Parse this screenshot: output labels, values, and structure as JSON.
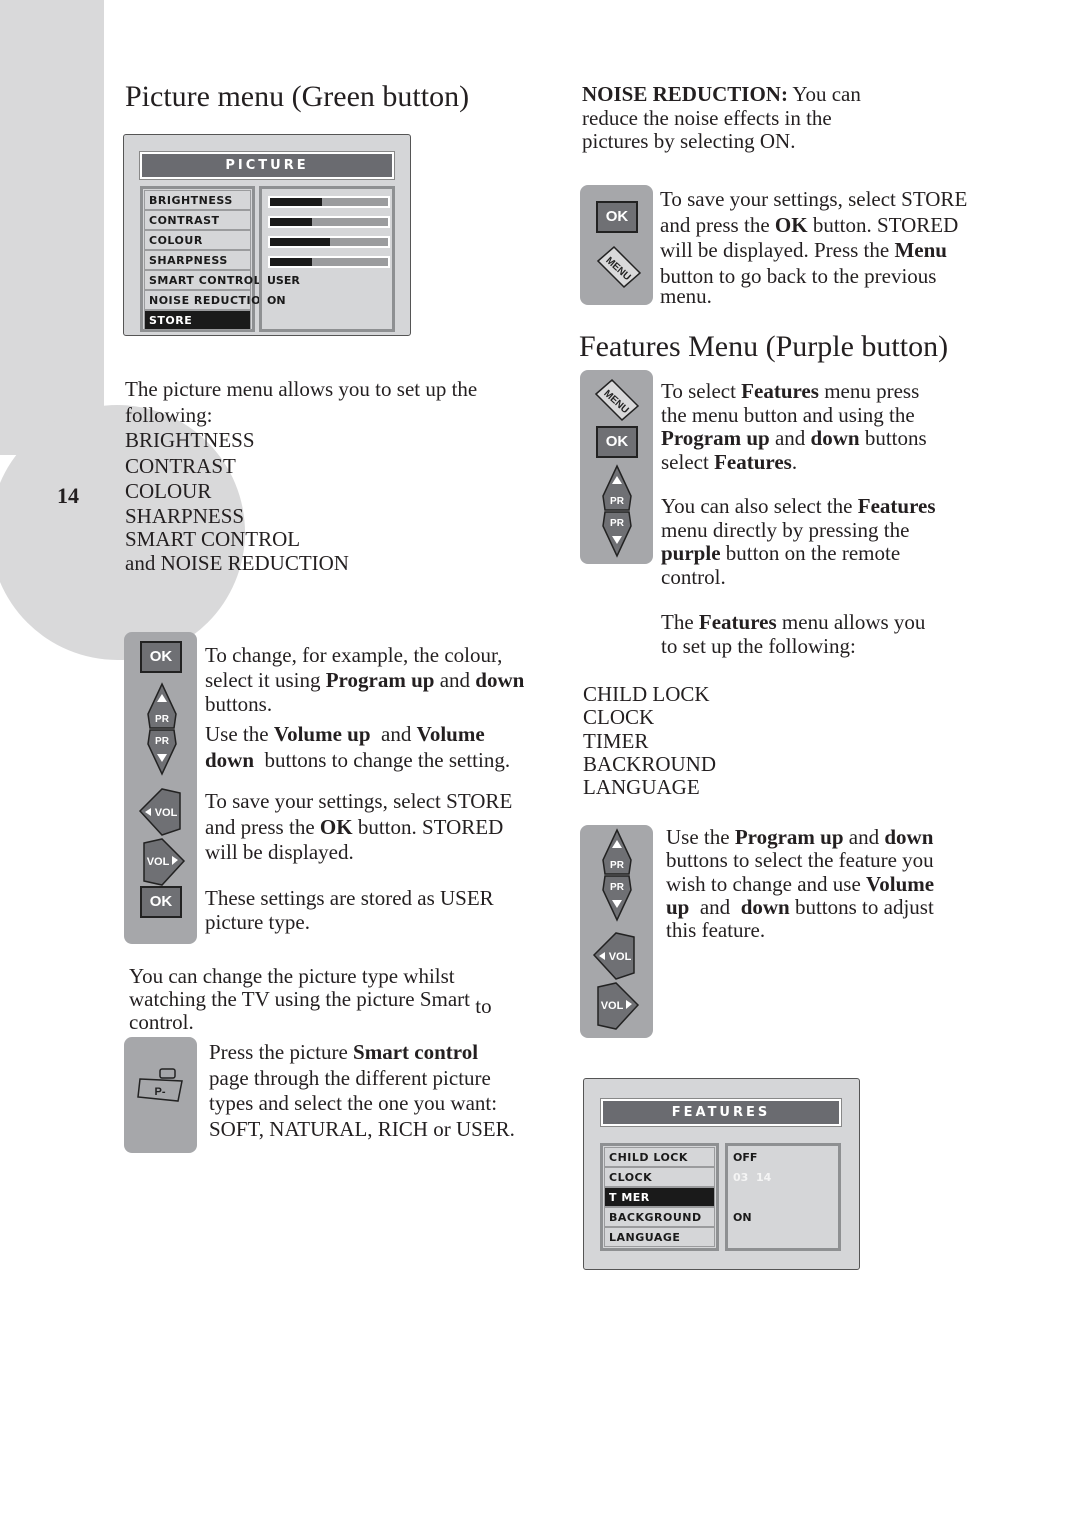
{
  "page_number": "14",
  "left": {
    "title": "Picture menu (Green button)",
    "picture_menu": {
      "title": "PICTURE",
      "items": [
        {
          "label": "BRIGHTNESS",
          "type": "bar",
          "level_percent": 44
        },
        {
          "label": "CONTRAST",
          "type": "bar",
          "level_percent": 36
        },
        {
          "label": "COLOUR",
          "type": "bar",
          "level_percent": 51
        },
        {
          "label": "SHARPNESS",
          "type": "bar",
          "level_percent": 36
        },
        {
          "label": "SMART CONTROL",
          "type": "text",
          "value": "USER"
        },
        {
          "label": "NOISE REDUCTION",
          "type": "text",
          "value": "ON"
        },
        {
          "label": "STORE",
          "type": "none",
          "selected": true
        }
      ]
    },
    "intro_lines": [
      "The picture menu allows you to set up the",
      "following:",
      "BRIGHTNESS",
      "CONTRAST",
      "COLOUR",
      "SHARPNESS",
      "SMART CONTROL",
      "and NOISE REDUCTION"
    ],
    "change_para": {
      "l1": "To change, for example, the colour,",
      "l2a": "select it using ",
      "l2b": "Program up",
      "l2c": " and ",
      "l2d": "down",
      "l3": "buttons."
    },
    "volume_para": {
      "l1a": "Use the ",
      "l1b": "Volume up",
      "l1c": "  and ",
      "l1d": "Volume",
      "l2a": "down",
      "l2b": "  buttons to change the setting."
    },
    "store_para": {
      "l1": "To save your settings, select STORE",
      "l2a": "and press the ",
      "l2b": "OK",
      "l2c": " button. STORED",
      "l3": "will be displayed."
    },
    "user_para": {
      "l1": "These settings are stored as USER",
      "l2": "picture type."
    },
    "smart_para": {
      "l1": "You can change the picture type whilst",
      "l2": "watching the TV using the picture Smart",
      "l2_to": "to",
      "l3": "control."
    },
    "press_para": {
      "l1a": "Press the picture ",
      "l1b": "Smart control",
      "l2": "page through the different picture",
      "l3": "types and select the one you want:",
      "l4": "SOFT, NATURAL, RICH or USER."
    },
    "buttons": {
      "ok": "OK",
      "pr": "PR",
      "vol": "VOL",
      "p_minus": "P-"
    }
  },
  "right": {
    "noise_para": {
      "l1a": "NOISE REDUCTION:",
      "l1b": " You can",
      "l2": "reduce the noise effects in the",
      "l3": "pictures by selecting ON."
    },
    "store_para": {
      "l1": "To save your settings, select STORE",
      "l2a": "and press the ",
      "l2b": "OK",
      "l2c": " button. STORED",
      "l3a": "will be displayed. Press the ",
      "l3b": "Menu",
      "l4": "button to go back to the previous",
      "l5": "menu."
    },
    "title": "Features Menu (Purple button)",
    "select_para": {
      "l1a": "To select ",
      "l1b": "Features",
      "l1c": " menu press",
      "l2": "the menu button and using the",
      "l3a": "Program up",
      "l3b": " and ",
      "l3c": "down",
      "l3d": " buttons",
      "l4a": "select ",
      "l4b": "Features",
      "l4c": "."
    },
    "purple_para": {
      "l1a": "You can also select the ",
      "l1b": "Features",
      "l2": "menu directly by pressing the",
      "l3a": "purple",
      "l3b": " button on the remote",
      "l4": "control."
    },
    "allows_para": {
      "l1a": "The ",
      "l1b": "Features",
      "l1c": " menu allows you",
      "l2": "to set up the following:"
    },
    "feature_list": [
      "CHILD LOCK",
      "CLOCK",
      "TIMER",
      "BACKROUND",
      "LANGUAGE"
    ],
    "use_para": {
      "l1a": "Use the ",
      "l1b": "Program up",
      "l1c": " and ",
      "l1d": "down",
      "l2": "buttons to select the feature you",
      "l3a": "wish to change and use ",
      "l3b": "Volume",
      "l4a": "up",
      "l4b": "  and  ",
      "l4c": "down",
      "l4d": " buttons to adjust",
      "l5": "this feature."
    },
    "features_menu": {
      "title": "FEATURES",
      "items": [
        {
          "label": "CHILD LOCK",
          "value": "OFF"
        },
        {
          "label": "CLOCK",
          "value": "03  14",
          "value_faded": true
        },
        {
          "label": "T MER",
          "value": "",
          "selected": true
        },
        {
          "label": "BACKGROUND",
          "value": "ON"
        },
        {
          "label": "LANGUAGE",
          "value": ""
        }
      ]
    },
    "buttons": {
      "ok": "OK",
      "menu": "MENU",
      "pr": "PR",
      "vol": "VOL"
    }
  }
}
